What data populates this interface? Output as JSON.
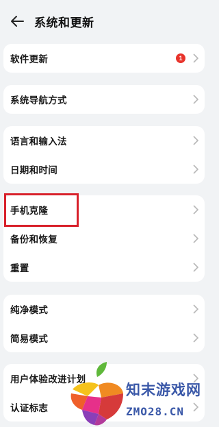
{
  "header": {
    "title": "系统和更新",
    "back_icon": "arrow-left-icon"
  },
  "cards": [
    {
      "items": [
        {
          "label": "软件更新",
          "badge": "1"
        }
      ]
    },
    {
      "items": [
        {
          "label": "系统导航方式"
        }
      ]
    },
    {
      "items": [
        {
          "label": "语言和输入法"
        },
        {
          "label": "日期和时间"
        }
      ]
    },
    {
      "items": [
        {
          "label": "手机克隆"
        },
        {
          "label": "备份和恢复"
        },
        {
          "label": "重置"
        }
      ]
    },
    {
      "items": [
        {
          "label": "纯净模式"
        },
        {
          "label": "简易模式"
        }
      ]
    },
    {
      "items": [
        {
          "label": "用户体验改进计划"
        },
        {
          "label": "认证标志"
        }
      ]
    }
  ],
  "colors": {
    "background": "#f1f3f5",
    "card": "#ffffff",
    "badge": "#e8332b",
    "highlight": "#d8202a",
    "watermark": "#3a58a8"
  },
  "watermark": {
    "text_cn": "知末游戏网",
    "text_en": "ZMO28.CN"
  }
}
